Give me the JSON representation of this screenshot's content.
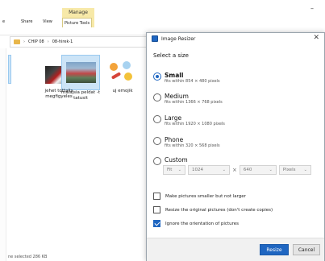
{
  "ribbon": {
    "context_group": "Manage",
    "tabs": [
      "e",
      "Share",
      "View",
      "Picture Tools"
    ],
    "minimize": "–"
  },
  "address": {
    "segments": [
      "CHIP 08",
      "08-hirek-1"
    ]
  },
  "files": [
    {
      "caption_line1": "jehet tottalis",
      "caption_line2": "megfigyeles"
    },
    {
      "caption_line1": "malajsia peldat -t",
      "caption_line2": "tatusit"
    },
    {
      "caption_line1": "uj emojik",
      "caption_line2": ""
    }
  ],
  "status": "ne selected  286 KB",
  "dialog": {
    "title": "Image Resizer",
    "close": "✕",
    "section": "Select a size",
    "options": [
      {
        "label": "Small",
        "desc": "fits within 854 × 480 pixels",
        "selected": true
      },
      {
        "label": "Medium",
        "desc": "fits within 1366 × 768 pixels",
        "selected": false
      },
      {
        "label": "Large",
        "desc": "fits within 1920 × 1080 pixels",
        "selected": false
      },
      {
        "label": "Phone",
        "desc": "fits within 320 × 568 pixels",
        "selected": false
      },
      {
        "label": "Custom",
        "desc": "",
        "selected": false
      }
    ],
    "custom": {
      "fit": "Fit",
      "width": "1024",
      "times": "×",
      "height": "640",
      "unit": "Pixels"
    },
    "checks": [
      {
        "label": "Make pictures smaller but not larger",
        "checked": false
      },
      {
        "label": "Resize the original pictures (don't create copies)",
        "checked": false
      },
      {
        "label": "Ignore the orientation of pictures",
        "checked": true
      }
    ],
    "buttons": {
      "resize": "Resize",
      "cancel": "Cancel"
    },
    "colors": {
      "accent": "#1f66c1",
      "context_tab": "#f7e9a8"
    }
  }
}
